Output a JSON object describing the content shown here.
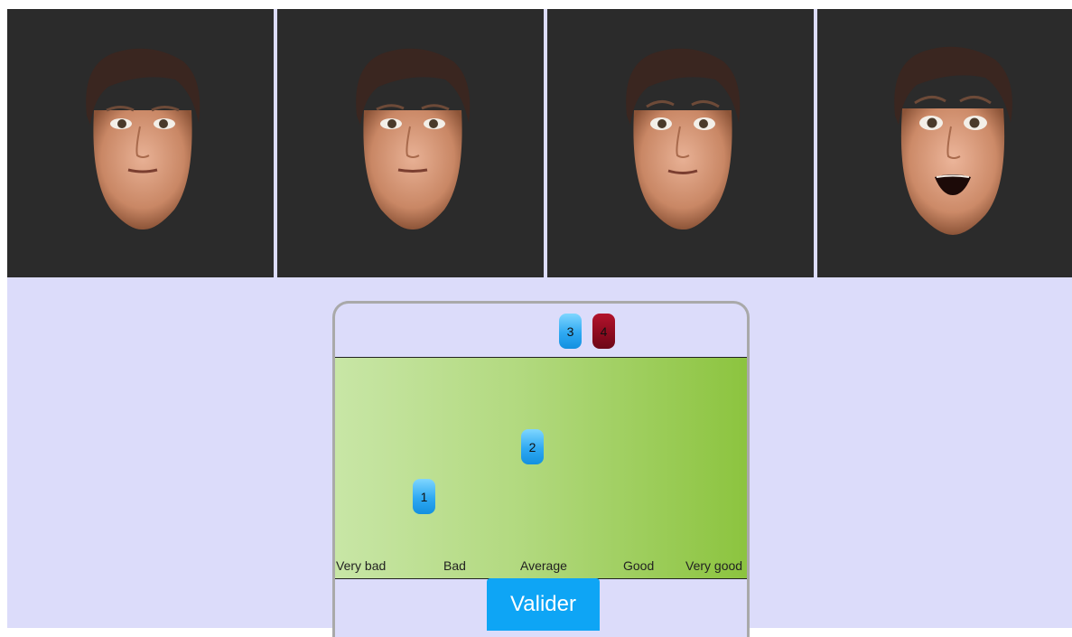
{
  "faces": [
    {
      "name": "face-neutral",
      "expression": "neutral"
    },
    {
      "name": "face-neutral-2",
      "expression": "neutral"
    },
    {
      "name": "face-slight",
      "expression": "slight"
    },
    {
      "name": "face-surprised",
      "expression": "surprised"
    }
  ],
  "queue_tokens": [
    {
      "label": "3",
      "color": "blue"
    },
    {
      "label": "4",
      "color": "red"
    }
  ],
  "scale": {
    "labels": [
      "Very bad",
      "Bad",
      "Average",
      "Good",
      "Very good"
    ],
    "placed_tokens": [
      {
        "label": "1",
        "color": "blue"
      },
      {
        "label": "2",
        "color": "blue"
      }
    ]
  },
  "submit_label": "Valider",
  "colors": {
    "background": "#dcdcfa",
    "panel": "#2b2b2b",
    "token_blue": "#1e9ff0",
    "token_red": "#8a0a1e",
    "button": "#0ea5f5",
    "scale_light": "#c8e6a6",
    "scale_dark": "#8cc43f"
  }
}
